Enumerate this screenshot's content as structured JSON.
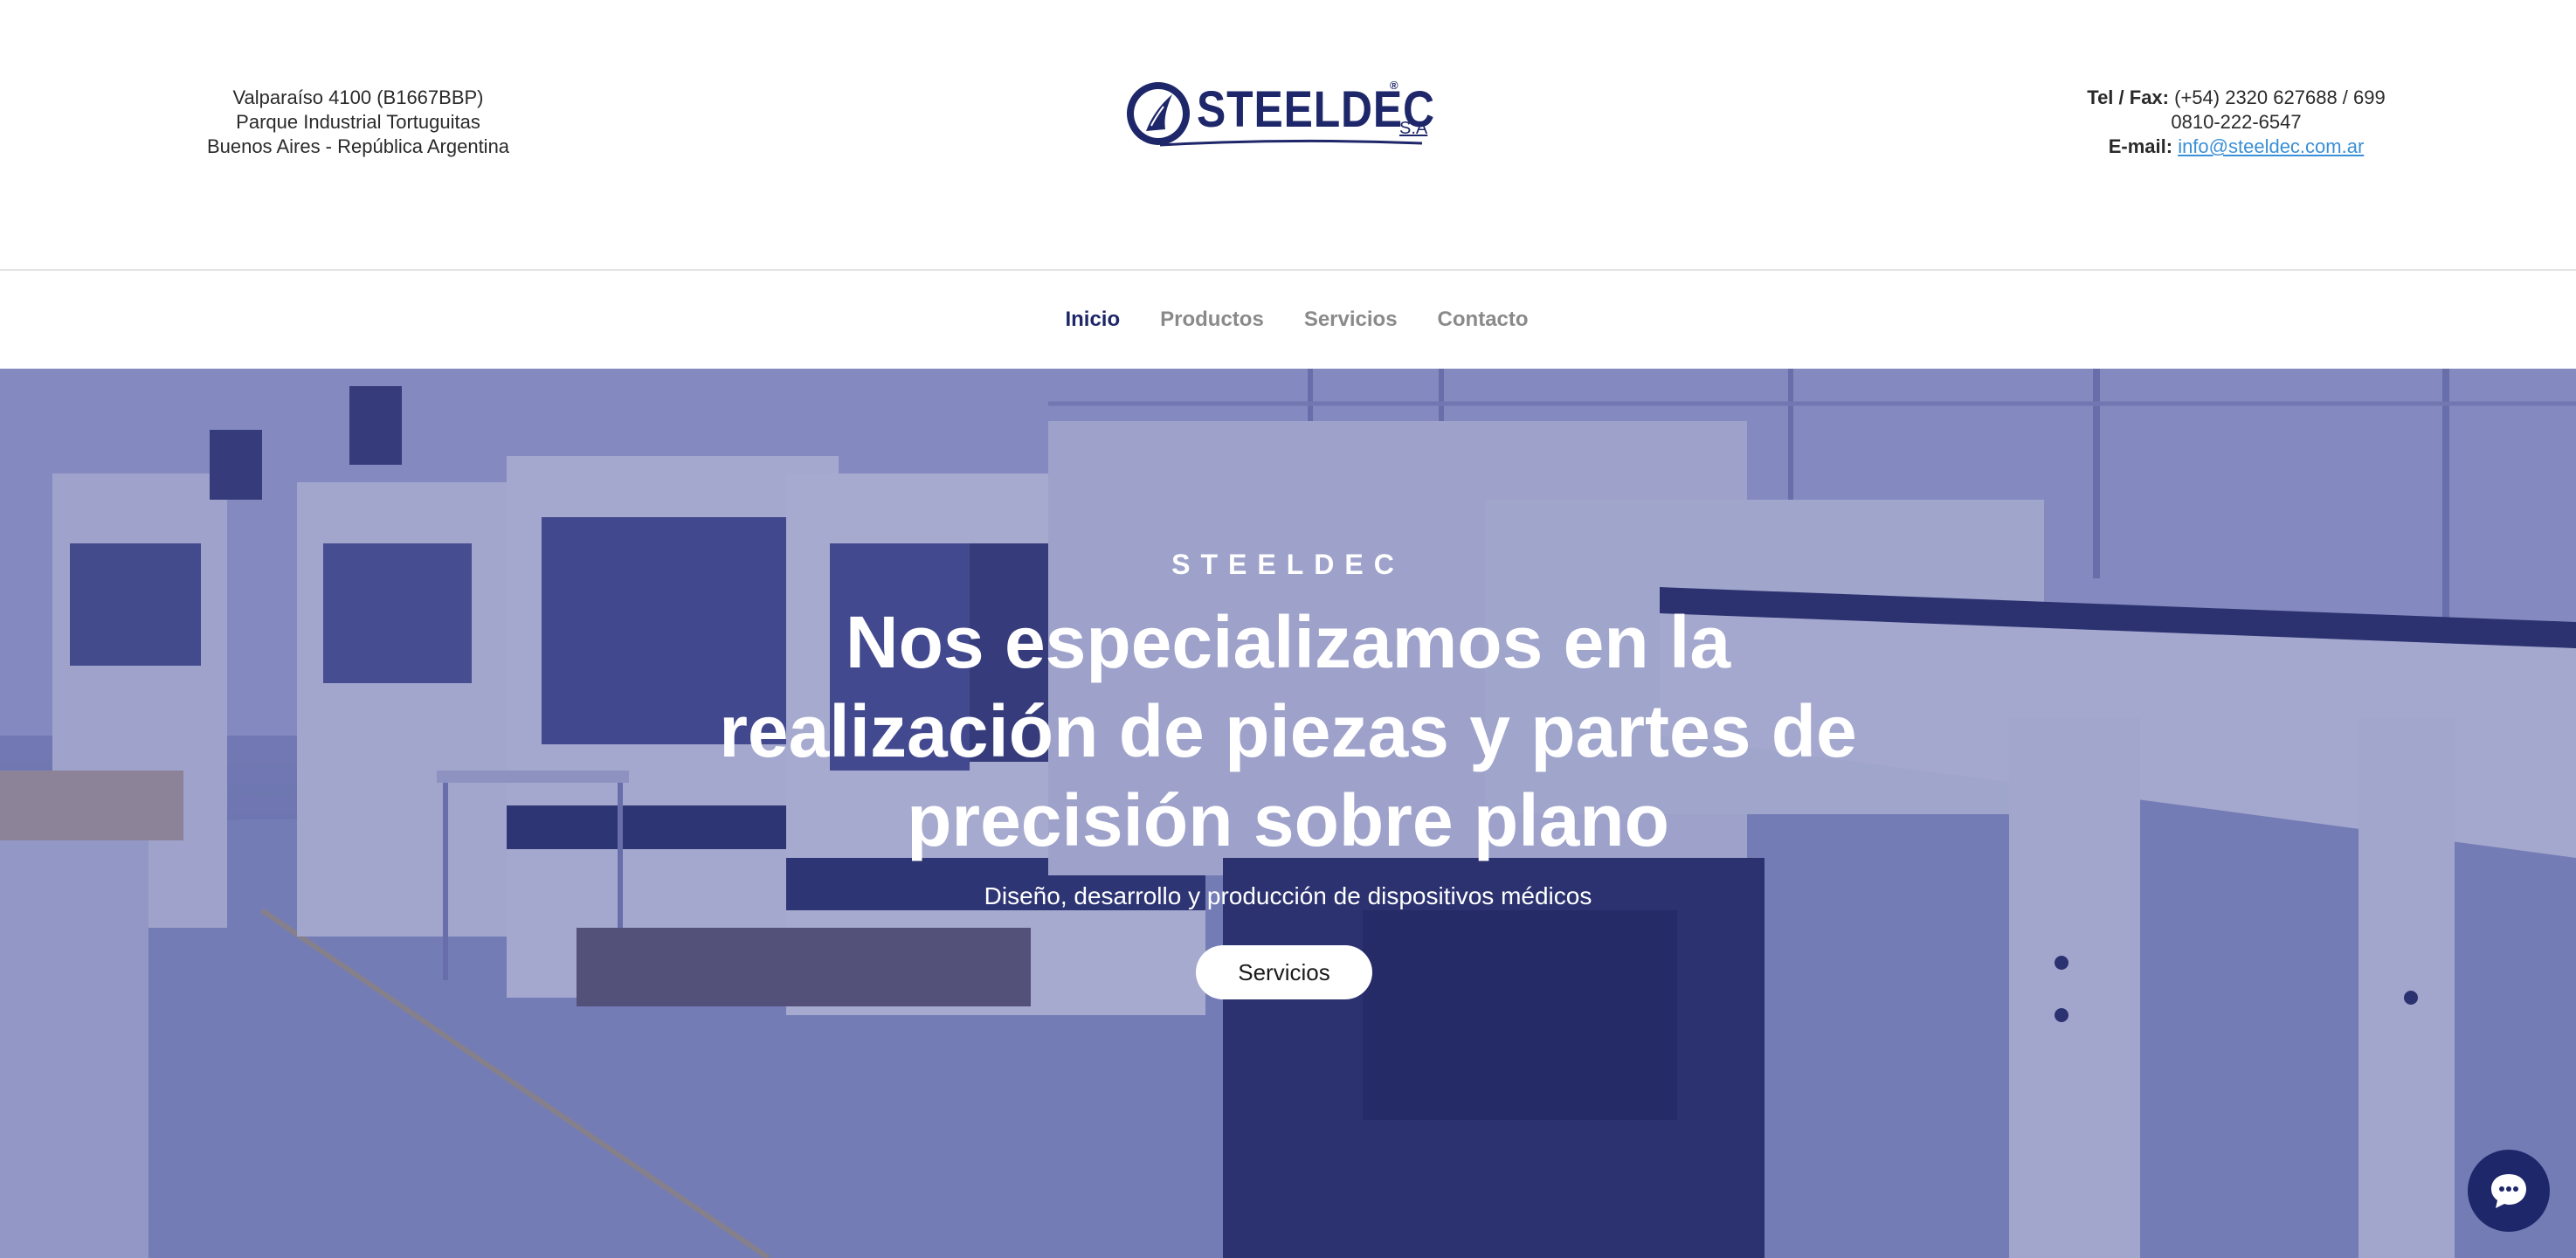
{
  "header": {
    "address_lines": [
      "Valparaíso 4100 (B1667BBP)",
      "Parque Industrial Tortuguitas",
      "Buenos Aires - República Argentina"
    ],
    "phone_label": "Tel / Fax:",
    "phone_value": "(+54) 2320 627688 / 699",
    "phone_alt": "0810-222-6547",
    "email_label": "E-mail:",
    "email_value": "info@steeldec.com.ar"
  },
  "logo": {
    "wordmark": "STEELDEC",
    "suffix": "S.A",
    "registered": "®",
    "icon": "steeldec-emblem-icon",
    "color": "#1e2769"
  },
  "nav": {
    "items": [
      {
        "label": "Inicio",
        "active": true
      },
      {
        "label": "Productos",
        "active": false
      },
      {
        "label": "Servicios",
        "active": false
      },
      {
        "label": "Contacto",
        "active": false
      }
    ],
    "active_color": "#1e2769",
    "inactive_color": "#8a8a8a"
  },
  "hero": {
    "eyebrow": "STEELDEC",
    "headline_lines": [
      "Nos especializamos en la",
      "realización de piezas y partes de",
      "precisión sobre plano"
    ],
    "subline": "Diseño, desarrollo y producción de dispositivos médicos",
    "cta_label": "Servicios",
    "overlay_color": "#30378c"
  },
  "chat_widget": {
    "icon": "chat-bubble-icon",
    "color": "#1e2769"
  }
}
